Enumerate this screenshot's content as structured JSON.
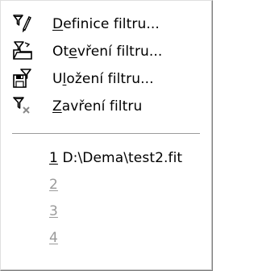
{
  "menu": {
    "items": [
      {
        "pre": "",
        "accel": "D",
        "post": "efinice filtru...",
        "icon": "filter-define-icon"
      },
      {
        "pre": "Ot",
        "accel": "e",
        "post": "vření filtru...",
        "icon": "filter-open-icon"
      },
      {
        "pre": "U",
        "accel": "l",
        "post": "ožení filtru...",
        "icon": "filter-save-icon"
      },
      {
        "pre": "",
        "accel": "Z",
        "post": "avření filtru",
        "icon": "filter-close-icon"
      }
    ],
    "recent": [
      {
        "num": "1",
        "path": "D:\\Dema\\test2.fit",
        "enabled": true
      },
      {
        "num": "2",
        "path": "",
        "enabled": false
      },
      {
        "num": "3",
        "path": "",
        "enabled": false
      },
      {
        "num": "4",
        "path": "",
        "enabled": false
      }
    ]
  }
}
